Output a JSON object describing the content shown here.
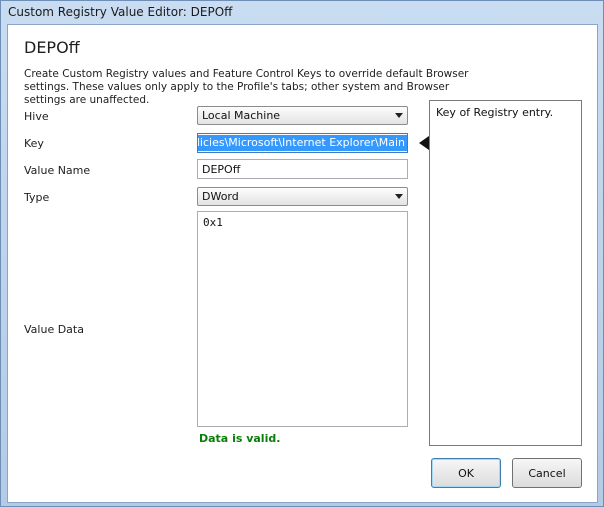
{
  "window": {
    "title": "Custom Registry Value Editor: DEPOff"
  },
  "form": {
    "heading": "DEPOff",
    "description": "Create Custom Registry values and Feature Control Keys to override default Browser settings. These values only apply to the Profile's tabs; other system and Browser settings are unaffected.",
    "hive_label": "Hive",
    "hive_value": "Local Machine",
    "key_label": "Key",
    "key_value": "e\\Policies\\Microsoft\\Internet Explorer\\Main",
    "value_name_label": "Value Name",
    "value_name": "DEPOff",
    "type_label": "Type",
    "type_value": "DWord",
    "value_data_label": "Value Data",
    "value_data": "0x1",
    "validation": "Data is valid.",
    "validation_color": "#0a7d0a"
  },
  "help": {
    "text": "Key of Registry entry."
  },
  "buttons": {
    "ok": "OK",
    "cancel": "Cancel"
  }
}
